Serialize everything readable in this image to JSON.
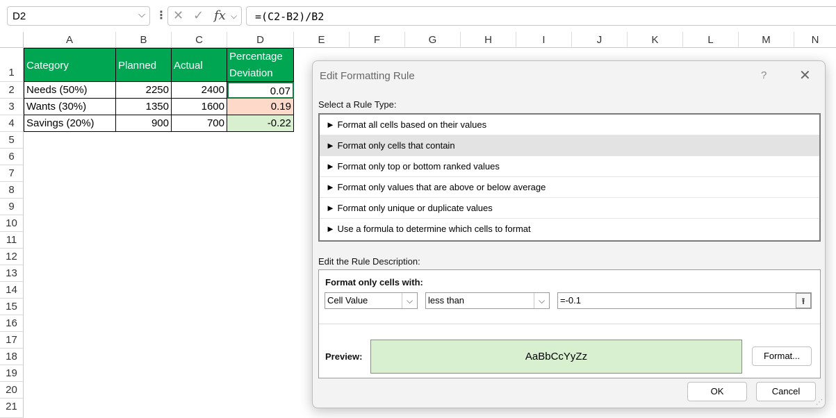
{
  "formula_bar": {
    "name_box": "D2",
    "formula": "=(C2-B2)/B2",
    "cancel_glyph": "✕",
    "enter_glyph": "✓",
    "fx_glyph": "fx"
  },
  "columns": [
    "A",
    "B",
    "C",
    "D",
    "E",
    "F",
    "G",
    "H",
    "I",
    "J",
    "K",
    "L",
    "M",
    "N"
  ],
  "rows": [
    "1",
    "2",
    "3",
    "4",
    "5",
    "6",
    "7",
    "8",
    "9",
    "10",
    "11",
    "12",
    "13",
    "14",
    "15",
    "16",
    "17",
    "18",
    "19",
    "20",
    "21"
  ],
  "table": {
    "headers": [
      "Category",
      "Planned",
      "Actual",
      "Percentage Deviation"
    ],
    "rows": [
      [
        "Needs (50%)",
        "2250",
        "2400",
        "0.07"
      ],
      [
        "Wants (30%)",
        "1350",
        "1600",
        "0.19"
      ],
      [
        "Savings (20%)",
        "900",
        "700",
        "-0.22"
      ]
    ],
    "header_color": "#00a651",
    "highlight_red": "#fcd9c9",
    "highlight_green": "#d8f0d0"
  },
  "dialog": {
    "title": "Edit Formatting Rule",
    "help": "?",
    "close": "✕",
    "select_rule_label": "Select a Rule Type:",
    "rule_types": [
      "► Format all cells based on their values",
      "► Format only cells that contain",
      "► Format only top or bottom ranked values",
      "► Format only values that are above or below average",
      "► Format only unique or duplicate values",
      "► Use a formula to determine which cells to format"
    ],
    "edit_desc_label": "Edit the Rule Description:",
    "format_only_label": "Format only cells with:",
    "condition_field": "Cell Value",
    "operator": "less than",
    "value": "=-0.1",
    "preview_label": "Preview:",
    "preview_text": "AaBbCcYyZz",
    "format_button": "Format...",
    "ok_button": "OK",
    "cancel_button": "Cancel"
  }
}
